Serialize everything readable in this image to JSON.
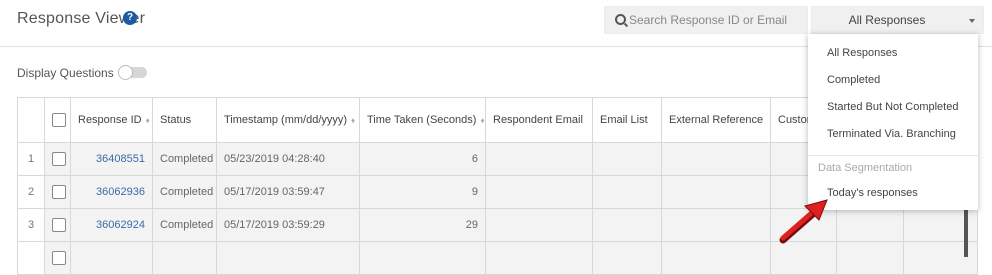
{
  "header": {
    "title": "Response Viewer",
    "help_icon": "?"
  },
  "search": {
    "placeholder": "Search Response ID or Email",
    "icon": "search-icon"
  },
  "filter_select": {
    "value": "All Responses"
  },
  "display_questions": {
    "label": "Display Questions",
    "toggle_state": "off"
  },
  "table": {
    "columns": [
      "Response ID",
      "Status",
      "Timestamp (mm/dd/yyyy)",
      "Time Taken (Seconds)",
      "Respondent Email",
      "Email List",
      "External Reference",
      "Custom"
    ],
    "sortable": [
      true,
      false,
      true,
      true,
      false,
      false,
      false,
      false
    ],
    "rows": [
      {
        "num": "1",
        "id": "36408551",
        "status": "Completed",
        "timestamp": "05/23/2019 04:28:40",
        "time_taken": "6"
      },
      {
        "num": "2",
        "id": "36062936",
        "status": "Completed",
        "timestamp": "05/17/2019 03:59:47",
        "time_taken": "9"
      },
      {
        "num": "3",
        "id": "36062924",
        "status": "Completed",
        "timestamp": "05/17/2019 03:59:29",
        "time_taken": "29"
      }
    ]
  },
  "dropdown_menu": {
    "items": [
      "All Responses",
      "Completed",
      "Started But Not Completed",
      "Terminated Via. Branching"
    ],
    "group_label": "Data Segmentation",
    "group_items": [
      "Today's responses"
    ]
  },
  "colors": {
    "accent": "#1d5aa6",
    "link": "#3a6aa8",
    "arrow": "#e02020"
  }
}
